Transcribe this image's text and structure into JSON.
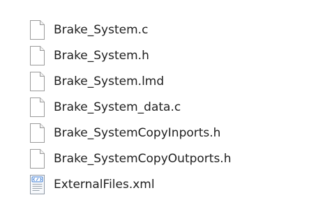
{
  "files": [
    {
      "name": "Brake_System.c",
      "icon": "document-icon"
    },
    {
      "name": "Brake_System.h",
      "icon": "document-icon"
    },
    {
      "name": "Brake_System.lmd",
      "icon": "document-icon"
    },
    {
      "name": "Brake_System_data.c",
      "icon": "document-icon"
    },
    {
      "name": "Brake_SystemCopyInports.h",
      "icon": "document-icon"
    },
    {
      "name": "Brake_SystemCopyOutports.h",
      "icon": "document-icon"
    },
    {
      "name": "ExternalFiles.xml",
      "icon": "xml-file-icon"
    }
  ],
  "colors": {
    "text": "#1e1e1e",
    "icon_border": "#9a9a9a",
    "xml_accent": "#3a7bd5"
  }
}
